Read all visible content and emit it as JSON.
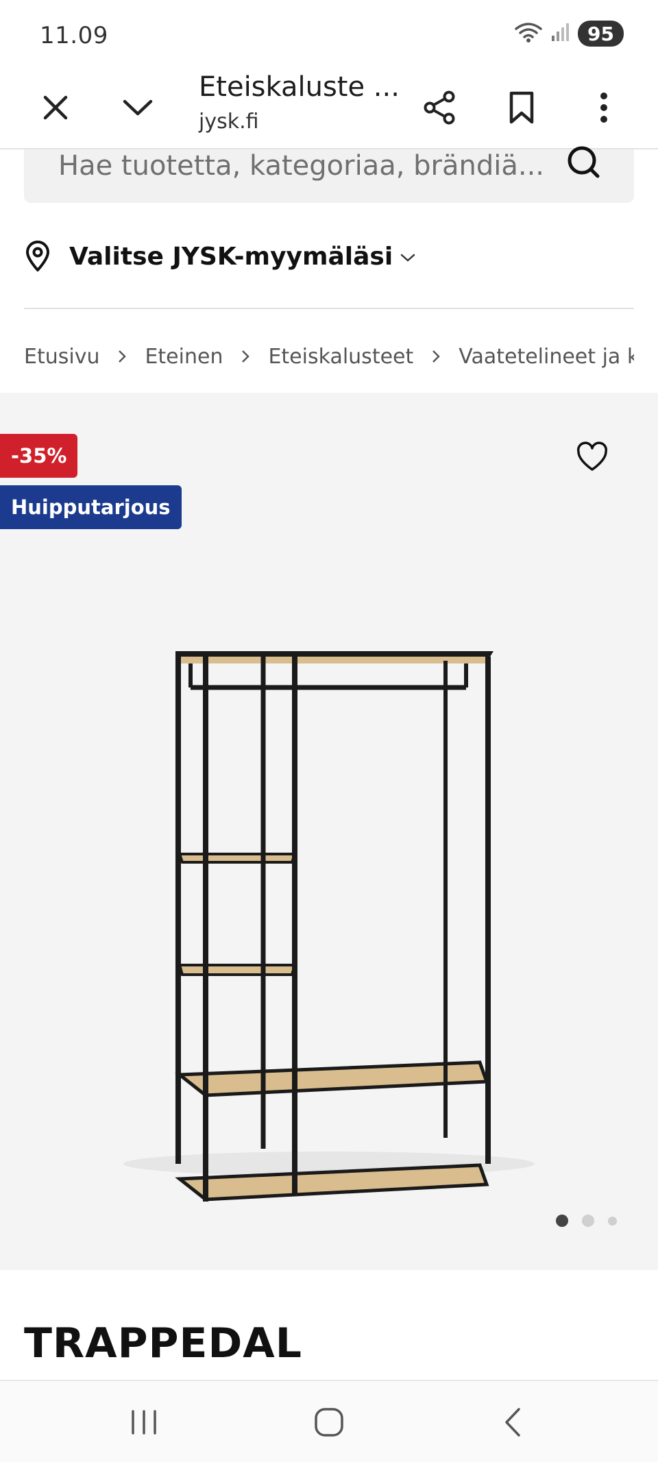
{
  "status_bar": {
    "time": "11.09",
    "battery": "95"
  },
  "tab": {
    "title": "Eteiskaluste ...",
    "url": "jysk.fi"
  },
  "search": {
    "placeholder": "Hae tuotetta, kategoriaa, brändiä..."
  },
  "store": {
    "label": "Valitse JYSK-myymäläsi"
  },
  "breadcrumb": [
    "Etusivu",
    "Eteinen",
    "Eteiskalusteet",
    "Vaatetelineet ja kenkä"
  ],
  "badges": {
    "discount": "-35%",
    "deal": "Huipputarjous"
  },
  "gallery": {
    "image_count": 3,
    "active_index": 0
  },
  "product": {
    "name": "TRAPPEDAL"
  },
  "colors": {
    "discount_red": "#d0202b",
    "deal_blue": "#1c3b8f",
    "gallery_bg": "#f4f4f4",
    "shelf_wood": "#d9bd8e",
    "frame_black": "#1a1a1a"
  }
}
